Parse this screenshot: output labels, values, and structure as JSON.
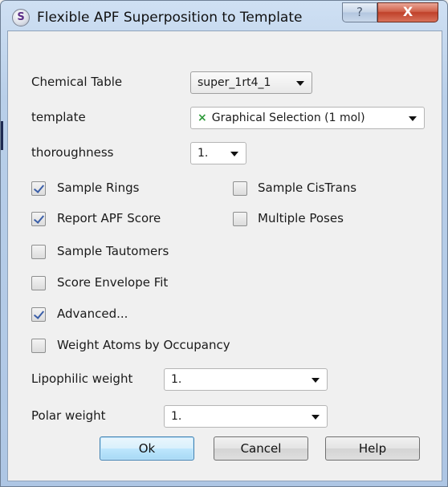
{
  "window": {
    "title": "Flexible APF Superposition to Template",
    "app_icon_glyph": "S",
    "help_glyph": "?",
    "close_glyph": "X"
  },
  "form": {
    "chemical_table_label": "Chemical Table",
    "chemical_table_value": "super_1rt4_1",
    "template_label": "template",
    "template_icon": "×",
    "template_value": "Graphical Selection (1 mol)",
    "thoroughness_label": "thoroughness",
    "thoroughness_value": "1.",
    "lipophilic_label": "Lipophilic weight",
    "lipophilic_value": "1.",
    "polar_label": "Polar weight",
    "polar_value": "1."
  },
  "checkboxes": {
    "sample_rings": {
      "label": "Sample Rings",
      "checked": true
    },
    "sample_cistrans": {
      "label": "Sample CisTrans",
      "checked": false
    },
    "report_apf_score": {
      "label": "Report APF Score",
      "checked": true
    },
    "multiple_poses": {
      "label": "Multiple Poses",
      "checked": false
    },
    "sample_tautomers": {
      "label": "Sample Tautomers",
      "checked": false
    },
    "score_envelope_fit": {
      "label": "Score Envelope Fit",
      "checked": false
    },
    "advanced": {
      "label": "Advanced...",
      "checked": true
    },
    "weight_atoms": {
      "label": "Weight Atoms by Occupancy",
      "checked": false
    }
  },
  "buttons": {
    "ok": "Ok",
    "cancel": "Cancel",
    "help": "Help"
  },
  "colors": {
    "accent_check": "#3a5ea8",
    "template_icon": "#2e9a3a",
    "close_button": "#c0412a"
  }
}
